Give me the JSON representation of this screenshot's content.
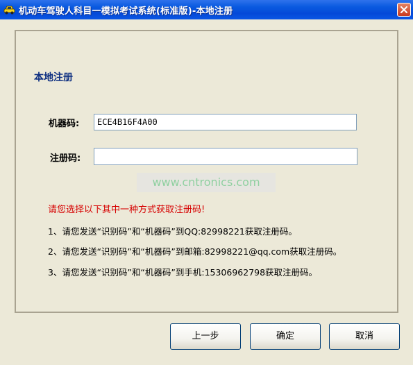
{
  "window": {
    "title": "机动车驾驶人科目一模拟考试系统(标准版)-本地注册"
  },
  "main": {
    "heading": "本地注册",
    "machine_code_label": "机器码:",
    "machine_code_value": "ECE4B16F4A00",
    "reg_code_label": "注册码:",
    "reg_code_value": "",
    "watermark": "www.cntronics.com",
    "notice": "请您选择以下其中一种方式获取注册码!",
    "options": [
      "1、请您发送“识别码”和“机器码”到QQ:82998221获取注册码。",
      "2、请您发送“识别码”和“机器码”到邮箱:82998221@qq.com获取注册码。",
      "3、请您发送“识别码”和“机器码”到手机:15306962798获取注册码。"
    ]
  },
  "buttons": {
    "prev": "上一步",
    "ok": "确定",
    "cancel": "取消"
  },
  "colors": {
    "titlebar": "#0a5ae0",
    "heading": "#0b2d80",
    "notice": "#d60000",
    "watermark": "#8fd0a0"
  },
  "icons": {
    "app": "car-icon",
    "close": "close-icon"
  }
}
